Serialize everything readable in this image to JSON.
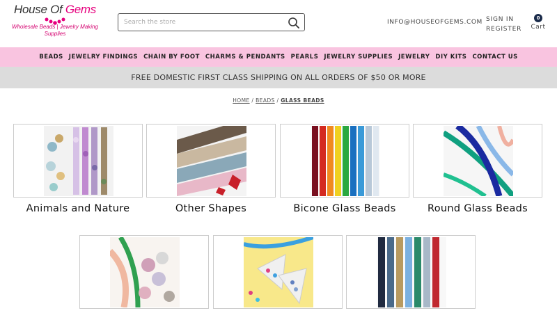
{
  "logo": {
    "title_main": "House Of ",
    "title_accent": "Gems",
    "tagline": "Wholesale Beads | Jewelry Making Supplies"
  },
  "search": {
    "placeholder": "Search the store"
  },
  "header": {
    "email": "INFO@HOUSEOFGEMS.COM",
    "sign_in": "SIGN IN",
    "register": "REGISTER",
    "cart_count": "0",
    "cart_label": "Cart"
  },
  "nav": {
    "items": [
      "BEADS",
      "JEWELRY FINDINGS",
      "CHAIN BY FOOT",
      "CHARMS & PENDANTS",
      "PEARLS",
      "JEWELRY SUPPLIES",
      "JEWELRY",
      "DIY KITS",
      "CONTACT US"
    ]
  },
  "banner": {
    "text": "FREE DOMESTIC FIRST CLASS SHIPPING ON ALL ORDERS OF $50 OR MORE"
  },
  "breadcrumb": {
    "home": "HOME",
    "beads": "BEADS",
    "current": "GLASS BEADS",
    "sep": "/"
  },
  "categories": [
    {
      "title": "Animals and Nature"
    },
    {
      "title": "Other Shapes"
    },
    {
      "title": "Bicone Glass Beads"
    },
    {
      "title": "Round Glass Beads"
    },
    {
      "title": ""
    },
    {
      "title": ""
    },
    {
      "title": ""
    }
  ],
  "colors": {
    "nav_bg": "#f9c4e0",
    "banner_bg": "#dcdcdc",
    "brand_pink": "#e6007e",
    "cart_badge": "#1a2b4a"
  }
}
